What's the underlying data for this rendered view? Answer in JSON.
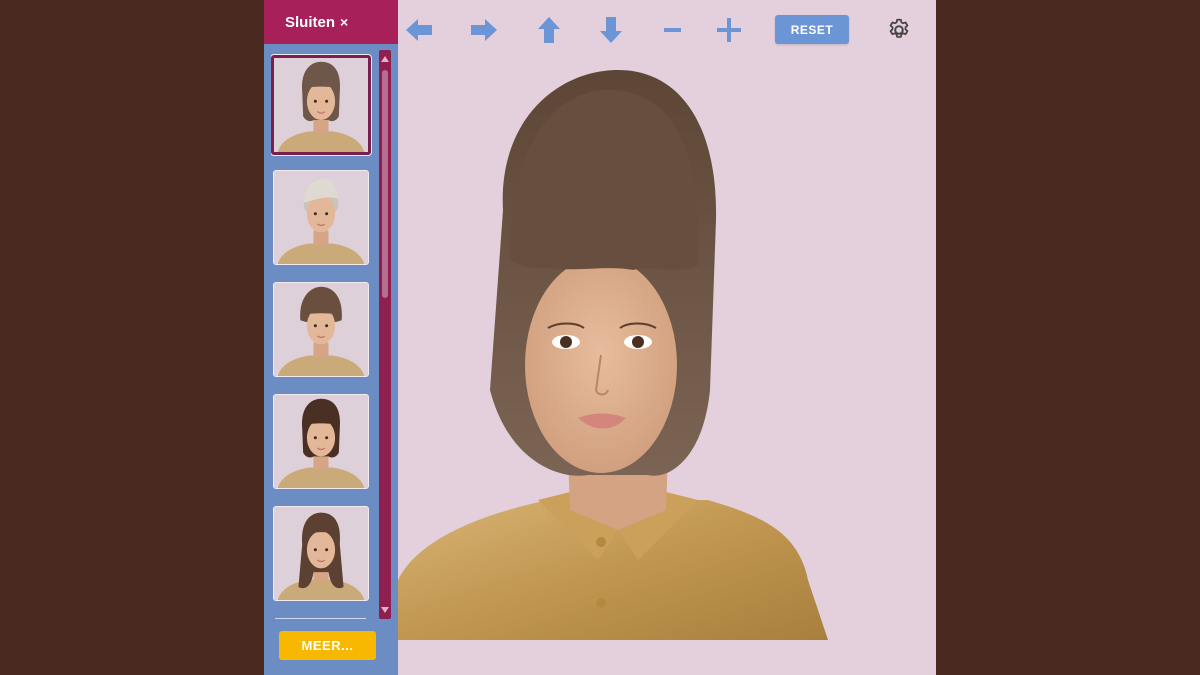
{
  "sidebar": {
    "close_label": "Sluiten",
    "close_symbol": "×",
    "more_label": "MEER...",
    "thumbnails": [
      {
        "style": "brown-bob-bangs",
        "hair": "#6e5648",
        "selected": true
      },
      {
        "style": "silver-pixie",
        "hair": "#c9c4bc",
        "selected": false
      },
      {
        "style": "brown-short-bob",
        "hair": "#6a4e3e",
        "selected": false
      },
      {
        "style": "dark-chin-bob",
        "hair": "#4a3024",
        "selected": false
      },
      {
        "style": "long-wavy-bangs",
        "hair": "#5c4132",
        "selected": false
      }
    ]
  },
  "toolbar": {
    "reset_label": "RESET",
    "icons": [
      "arrow-left-icon",
      "arrow-right-icon",
      "arrow-up-icon",
      "arrow-down-icon",
      "minus-icon",
      "plus-icon",
      "gear-icon"
    ]
  },
  "colors": {
    "page_bg": "#4a2a20",
    "canvas_bg": "#e3d0dc",
    "sidebar_bg": "#6c8cc4",
    "close_bar": "#a8205a",
    "accent_blue": "#6c95d6",
    "more_button": "#f8b800",
    "selected_border": "#7a1f4d"
  }
}
